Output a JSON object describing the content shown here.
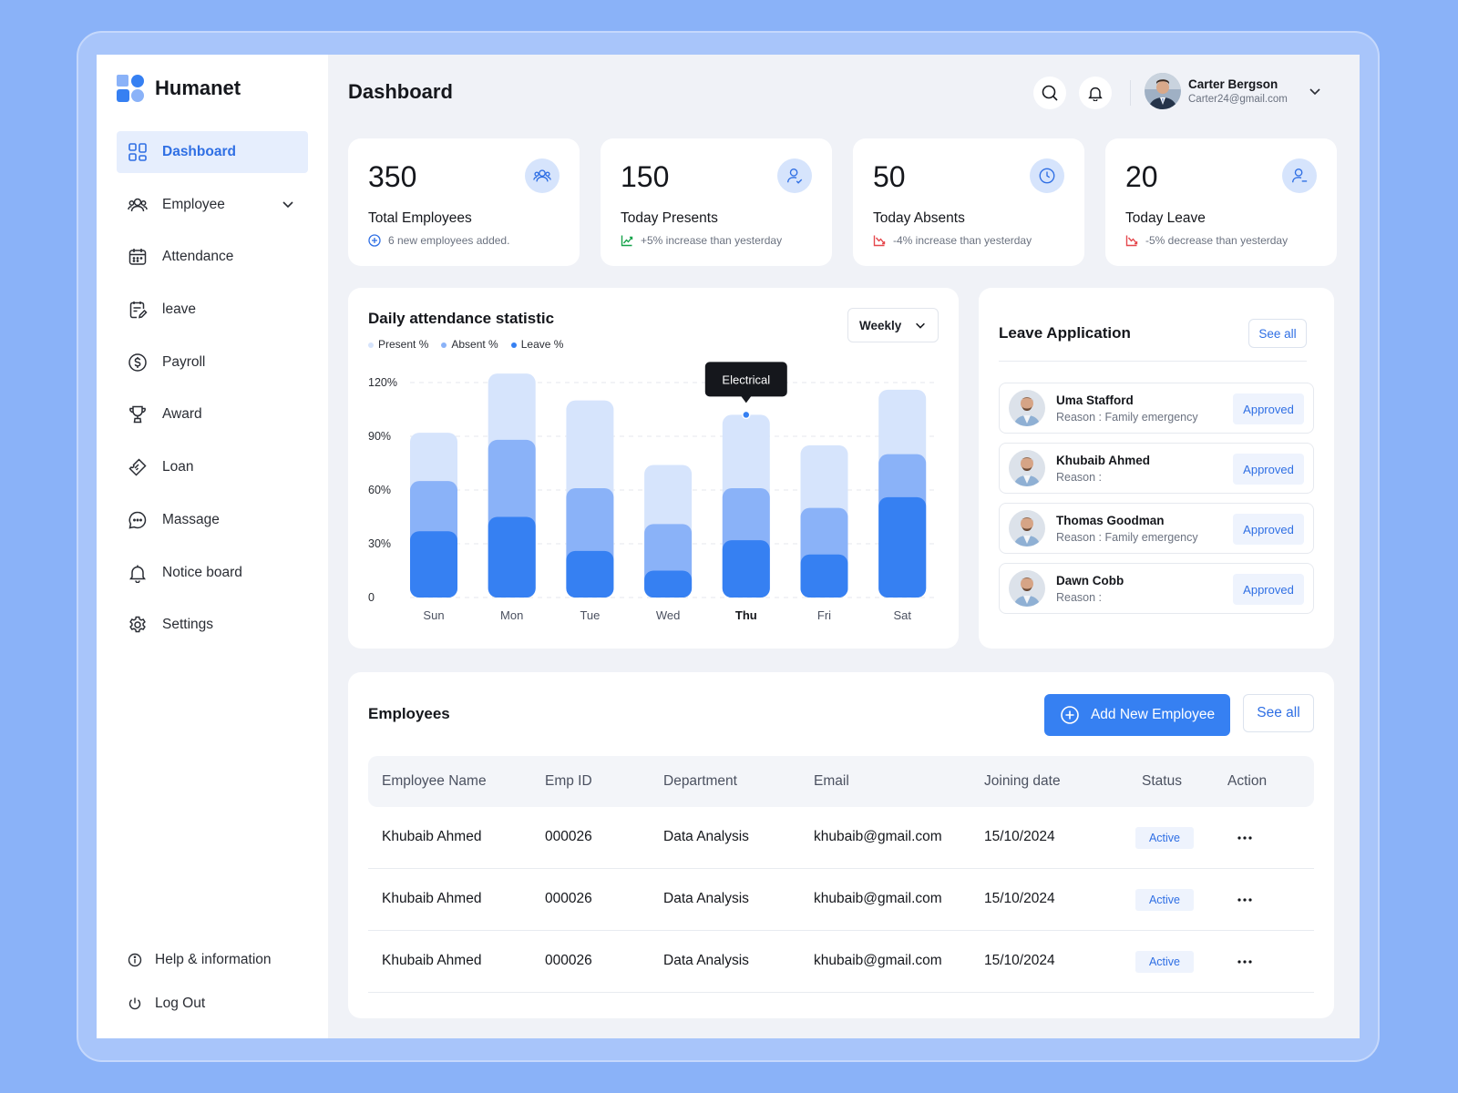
{
  "brand": {
    "name": "Humanet"
  },
  "sidebar": {
    "items": [
      {
        "label": "Dashboard",
        "icon": "grid-icon",
        "active": true
      },
      {
        "label": "Employee",
        "icon": "users-icon",
        "has_children": true
      },
      {
        "label": "Attendance",
        "icon": "calendar-icon"
      },
      {
        "label": "leave",
        "icon": "clipboard-edit-icon"
      },
      {
        "label": "Payroll",
        "icon": "dollar-icon"
      },
      {
        "label": "Award",
        "icon": "trophy-icon"
      },
      {
        "label": "Loan",
        "icon": "ticket-icon"
      },
      {
        "label": "Massage",
        "icon": "chat-icon"
      },
      {
        "label": "Notice board",
        "icon": "bell-icon"
      },
      {
        "label": "Settings",
        "icon": "gear-icon"
      }
    ],
    "bottom": {
      "help_label": "Help & information",
      "logout_label": "Log Out"
    }
  },
  "header": {
    "title": "Dashboard",
    "user": {
      "name": "Carter Bergson",
      "email": "Carter24@gmail.com"
    }
  },
  "stats": [
    {
      "value": "350",
      "label": "Total Employees",
      "sub": "6 new employees added.",
      "icon": "users-icon",
      "trend": "info"
    },
    {
      "value": "150",
      "label": "Today Presents",
      "sub": "+5% increase than yesterday",
      "icon": "user-check-icon",
      "trend": "up"
    },
    {
      "value": "50",
      "label": "Today Absents",
      "sub": "-4% increase than yesterday",
      "icon": "clock-icon",
      "trend": "down"
    },
    {
      "value": "20",
      "label": "Today Leave",
      "sub": "-5% decrease than yesterday",
      "icon": "user-minus-icon",
      "trend": "down"
    }
  ],
  "colors": {
    "present": "#D6E4FC",
    "absent": "#8AB2F8",
    "leave": "#3680F2",
    "accent": "#2F6FE4",
    "up": "#16A34A",
    "down": "#E5484D"
  },
  "chart": {
    "title": "Daily attendance statistic",
    "range_select": "Weekly",
    "tooltip": "Electrical",
    "tooltip_day_index": 4
  },
  "chart_data": {
    "type": "bar",
    "stacked": true,
    "categories": [
      "Sun",
      "Mon",
      "Tue",
      "Wed",
      "Thu",
      "Fri",
      "Sat"
    ],
    "series": [
      {
        "name": "Leave %",
        "values": [
          37,
          45,
          26,
          15,
          32,
          24,
          56
        ]
      },
      {
        "name": "Absent %",
        "values": [
          28,
          43,
          35,
          26,
          29,
          26,
          24
        ]
      },
      {
        "name": "Present %",
        "values": [
          27,
          37,
          49,
          33,
          41,
          35,
          36
        ]
      }
    ],
    "ylim": [
      0,
      120
    ],
    "yticks": [
      "0",
      "30%",
      "60%",
      "90%",
      "120%"
    ],
    "highlight_category": "Thu",
    "legend_order": [
      "Present %",
      "Absent %",
      "Leave %"
    ],
    "grid": true
  },
  "leave": {
    "title": "Leave Application",
    "see_all": "See all",
    "items": [
      {
        "name": "Uma Stafford",
        "reason": "Reason : Family emergency",
        "status": "Approved"
      },
      {
        "name": "Khubaib Ahmed",
        "reason": "Reason :",
        "status": "Approved"
      },
      {
        "name": "Thomas Goodman",
        "reason": "Reason : Family emergency",
        "status": "Approved"
      },
      {
        "name": "Dawn Cobb",
        "reason": "Reason :",
        "status": "Approved"
      }
    ]
  },
  "employees": {
    "title": "Employees",
    "add_button": "Add New Employee",
    "see_all": "See all",
    "columns": [
      "Employee Name",
      "Emp ID",
      "Department",
      "Email",
      "Joining date",
      "Status",
      "Action"
    ],
    "rows": [
      {
        "name": "Khubaib Ahmed",
        "id": "000026",
        "department": "Data Analysis",
        "email": "khubaib@gmail.com",
        "date": "15/10/2024",
        "status": "Active"
      },
      {
        "name": "Khubaib Ahmed",
        "id": "000026",
        "department": "Data Analysis",
        "email": "khubaib@gmail.com",
        "date": "15/10/2024",
        "status": "Active"
      },
      {
        "name": "Khubaib Ahmed",
        "id": "000026",
        "department": "Data Analysis",
        "email": "khubaib@gmail.com",
        "date": "15/10/2024",
        "status": "Active"
      }
    ]
  }
}
